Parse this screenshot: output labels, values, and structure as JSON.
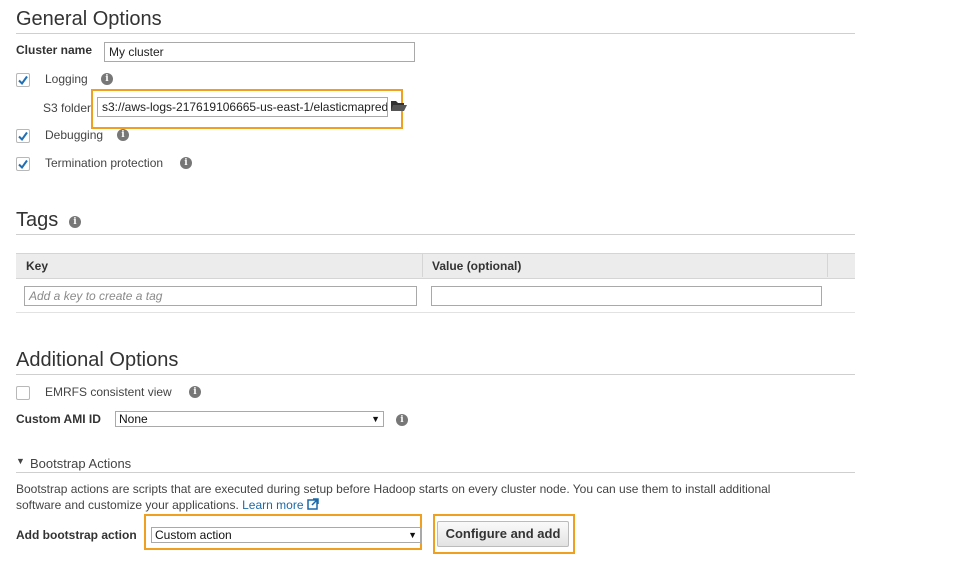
{
  "general": {
    "title": "General Options",
    "cluster_name_label": "Cluster name",
    "cluster_name_value": "My cluster",
    "logging_label": "Logging",
    "logging_checked": true,
    "s3_folder_label": "S3 folder",
    "s3_folder_value": "s3://aws-logs-217619106665-us-east-1/elasticmapred",
    "debugging_label": "Debugging",
    "debugging_checked": true,
    "termination_label": "Termination protection",
    "termination_checked": true
  },
  "tags": {
    "title": "Tags",
    "col_key": "Key",
    "col_value": "Value (optional)",
    "key_placeholder": "Add a key to create a tag",
    "value_value": ""
  },
  "additional": {
    "title": "Additional Options",
    "emrfs_label": "EMRFS consistent view",
    "emrfs_checked": false,
    "ami_label": "Custom AMI ID",
    "ami_value": "None"
  },
  "bootstrap": {
    "section_label": "Bootstrap Actions",
    "description_line1": "Bootstrap actions are scripts that are executed during setup before Hadoop starts on every cluster node. You can use them to install additional",
    "description_line2": "software and customize your applications.",
    "learn_more": "Learn more",
    "add_label": "Add bootstrap action",
    "action_value": "Custom action",
    "configure_button": "Configure and add"
  },
  "icons": {
    "info": "info-icon",
    "folder": "folder-icon",
    "external_link": "external-link-icon",
    "checkmark": "checkmark-icon",
    "dropdown": "dropdown-arrow-icon",
    "collapse": "collapse-triangle-icon"
  },
  "colors": {
    "highlight": "#f0a020",
    "check": "#1f6fb5",
    "link": "#1a6aa8"
  }
}
